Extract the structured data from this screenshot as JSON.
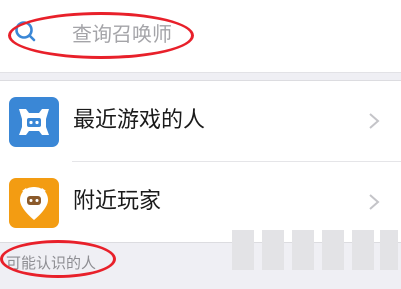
{
  "search": {
    "placeholder": "查询召唤师",
    "icon": "search-icon"
  },
  "list": {
    "items": [
      {
        "label": "最近游戏的人",
        "icon": "recent-players-icon",
        "icon_color": "#3a87d6"
      },
      {
        "label": "附近玩家",
        "icon": "nearby-players-icon",
        "icon_color": "#f39c12"
      }
    ]
  },
  "section": {
    "label": "可能认识的人"
  },
  "colors": {
    "accent_blue": "#3a87d6",
    "accent_orange": "#f39c12",
    "annotation_red": "#e8202a"
  }
}
